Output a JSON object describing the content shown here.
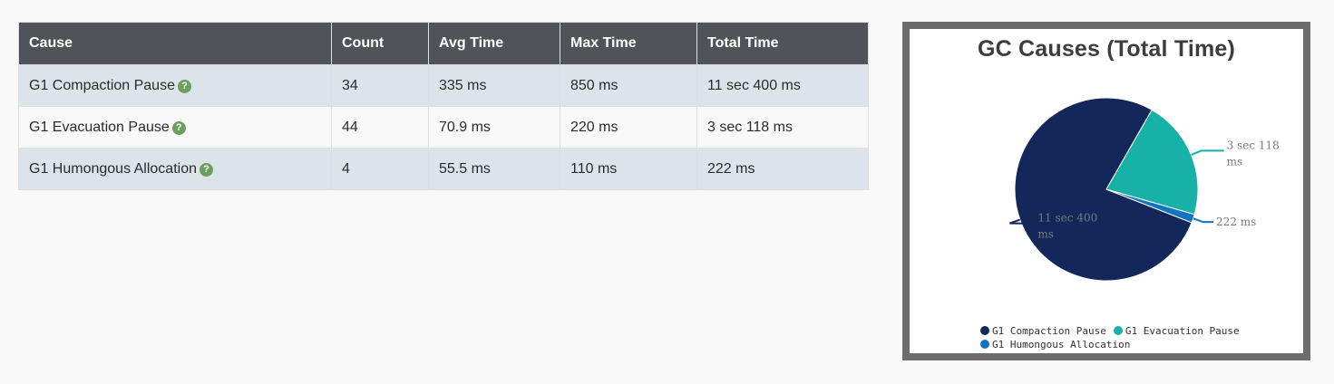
{
  "table": {
    "headers": [
      "Cause",
      "Count",
      "Avg Time",
      "Max Time",
      "Total Time"
    ],
    "rows": [
      {
        "cause": "G1 Compaction Pause",
        "count": "34",
        "avg": "335 ms",
        "max": "850 ms",
        "total": "11 sec 400 ms"
      },
      {
        "cause": "G1 Evacuation Pause",
        "count": "44",
        "avg": "70.9 ms",
        "max": "220 ms",
        "total": "3 sec 118 ms"
      },
      {
        "cause": "G1 Humongous Allocation",
        "count": "4",
        "avg": "55.5 ms",
        "max": "110 ms",
        "total": "222 ms"
      }
    ],
    "help_glyph": "?"
  },
  "chart_data": {
    "type": "pie",
    "title": "GC Causes (Total Time)",
    "categories": [
      "G1 Compaction Pause",
      "G1 Evacuation Pause",
      "G1 Humongous Allocation"
    ],
    "values": [
      11400,
      3118,
      222
    ],
    "value_unit": "ms",
    "data_labels": [
      "11 sec 400 ms",
      "3 sec 118 ms",
      "222 ms"
    ],
    "colors": [
      "#13275a",
      "#17b1a8",
      "#1273c2"
    ],
    "legend_position": "bottom"
  }
}
